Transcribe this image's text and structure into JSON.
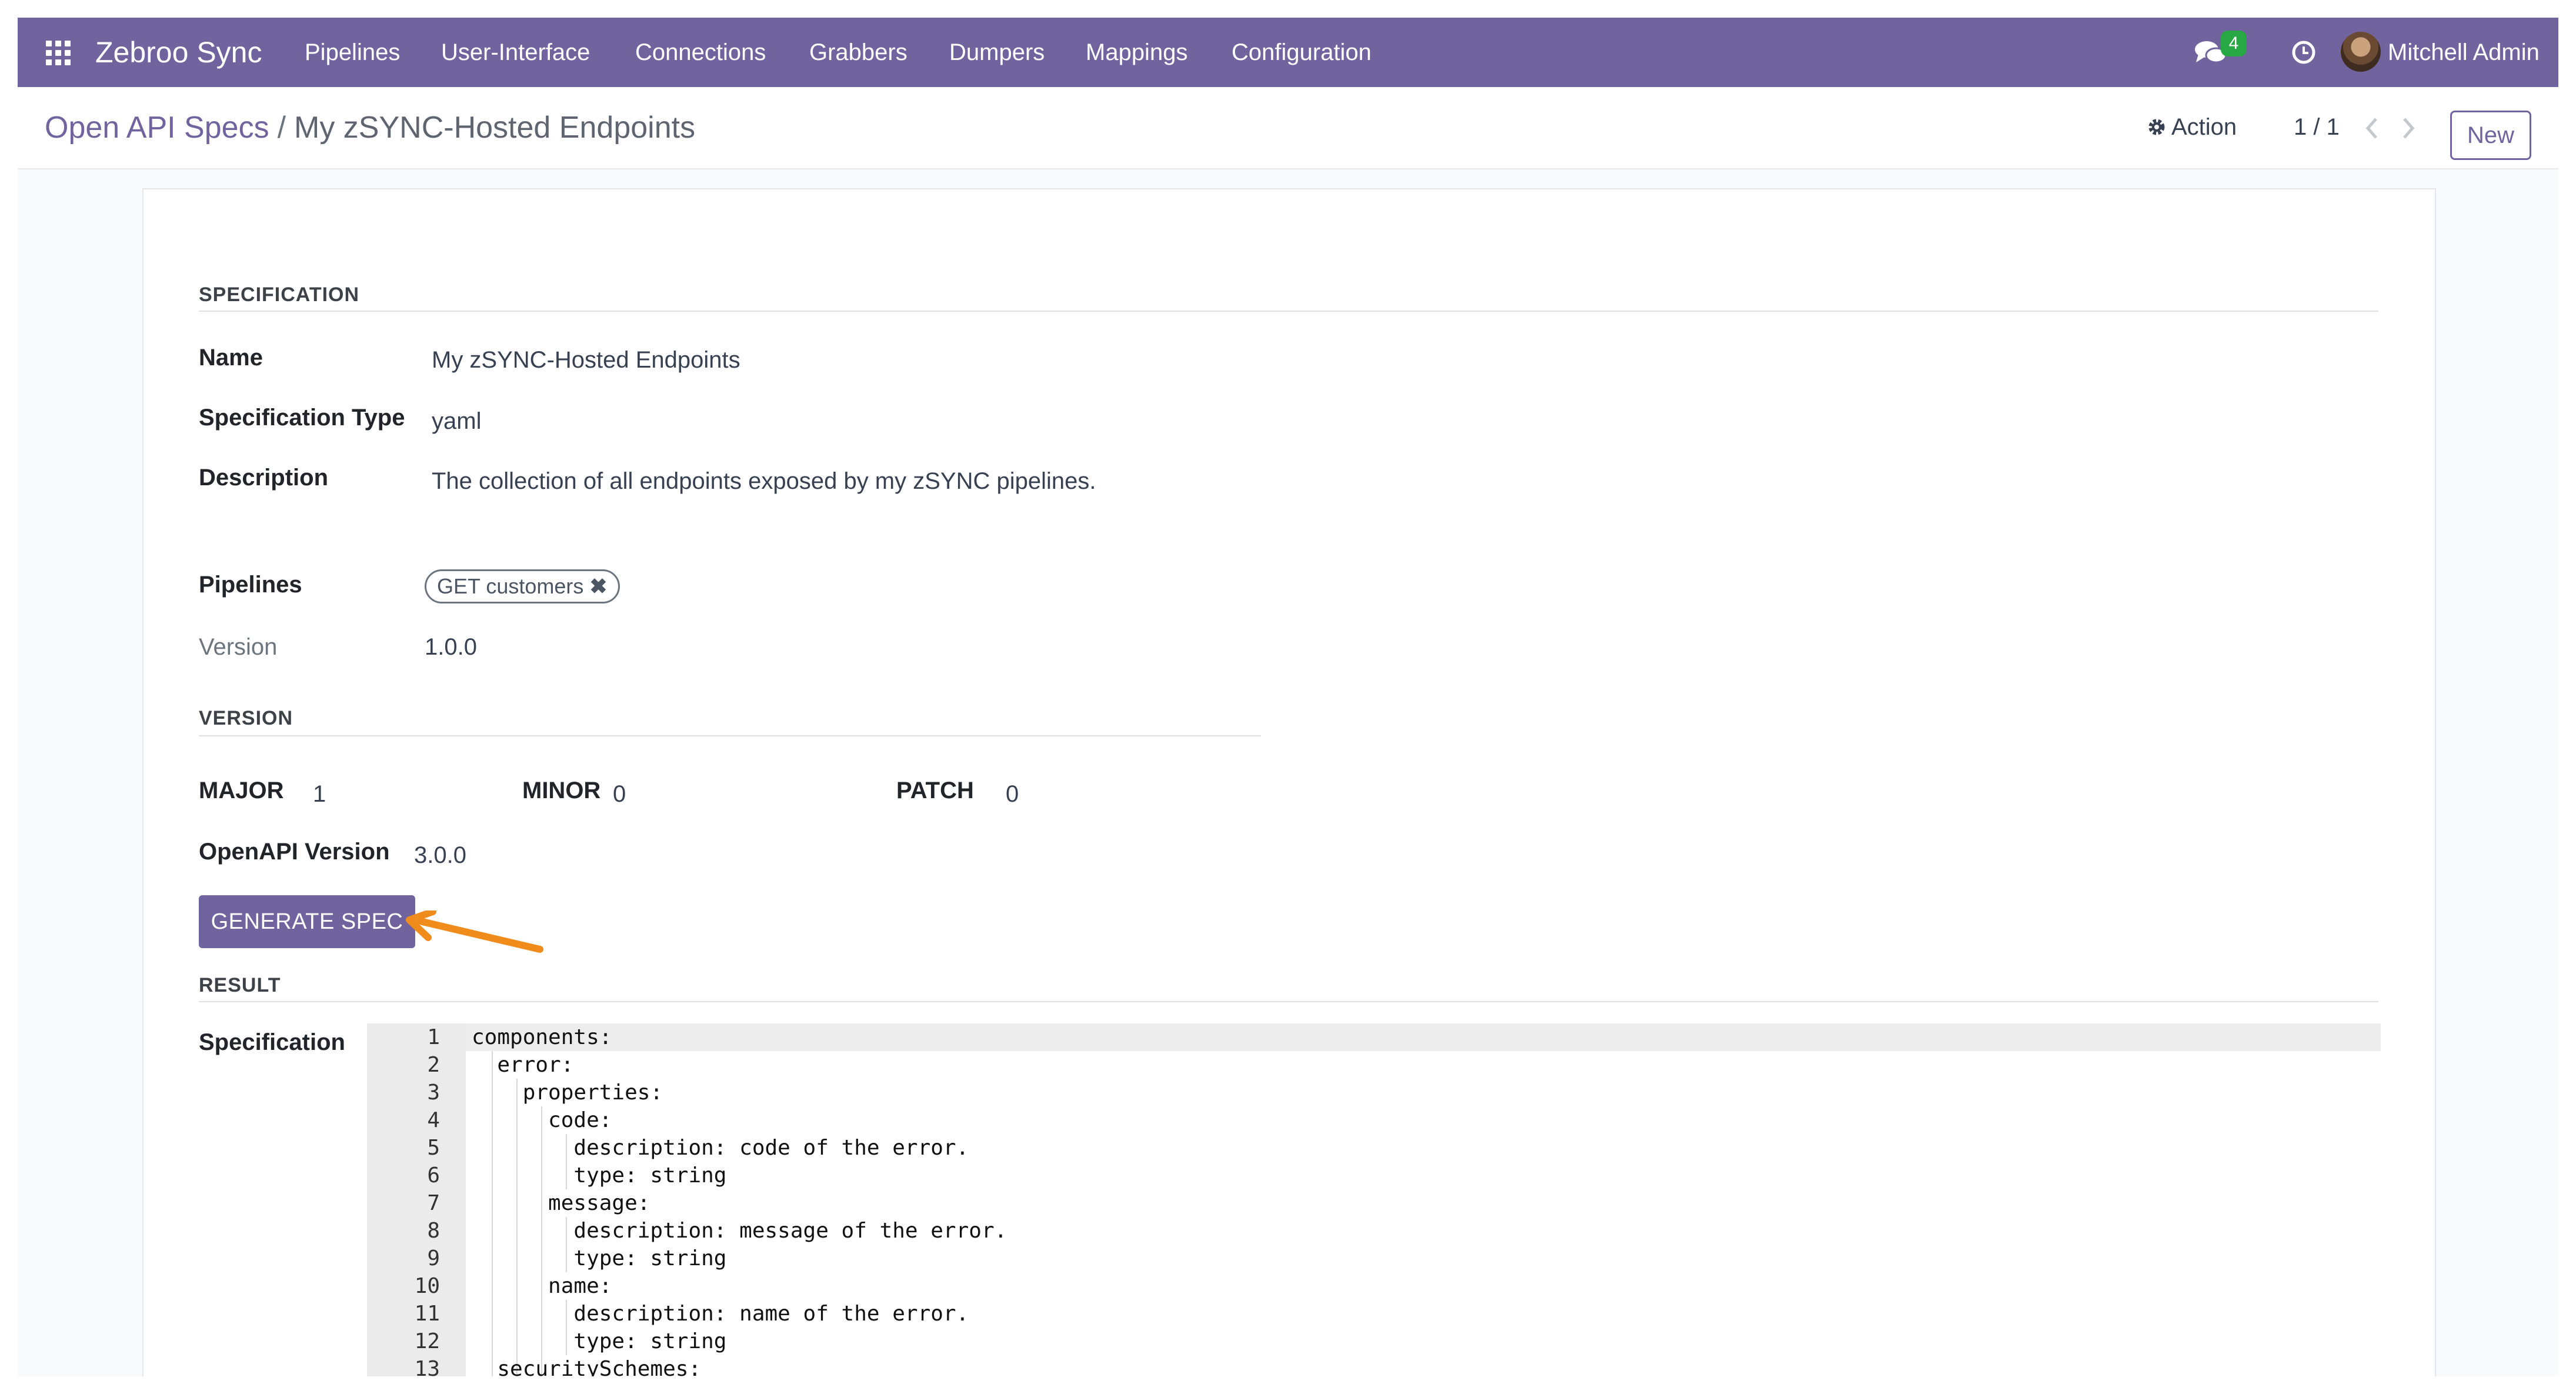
{
  "navbar": {
    "brand": "Zebroo Sync",
    "menu": [
      "Pipelines",
      "User-Interface",
      "Connections",
      "Grabbers",
      "Dumpers",
      "Mappings",
      "Configuration"
    ],
    "messages_count": "4",
    "user_name": "Mitchell Admin",
    "icons": [
      "apps-icon",
      "chat-icon",
      "clock-icon",
      "avatar"
    ]
  },
  "breadcrumb": {
    "parent": "Open API Specs",
    "separator": "/",
    "current": "My zSYNC-Hosted Endpoints"
  },
  "controls": {
    "action_label": "Action",
    "pager": "1 / 1",
    "new_label": "New"
  },
  "specification": {
    "section_title": "SPECIFICATION",
    "name_label": "Name",
    "name_value": "My zSYNC-Hosted Endpoints",
    "type_label": "Specification Type",
    "type_value": "yaml",
    "description_label": "Description",
    "description_value": "The collection of all endpoints exposed by my zSYNC pipelines.",
    "pipelines_label": "Pipelines",
    "pipeline_tag": "GET customers",
    "version_label": "Version",
    "version_value": "1.0.0"
  },
  "version": {
    "section_title": "VERSION",
    "major_label": "MAJOR",
    "major_value": "1",
    "minor_label": "MINOR",
    "minor_value": "0",
    "patch_label": "PATCH",
    "patch_value": "0",
    "openapi_label": "OpenAPI Version",
    "openapi_value": "3.0.0"
  },
  "generate_button": "GENERATE SPEC",
  "result": {
    "section_title": "RESULT",
    "spec_label": "Specification",
    "line_numbers": [
      "1",
      "2",
      "3",
      "4",
      "5",
      "6",
      "7",
      "8",
      "9",
      "10",
      "11",
      "12",
      "13"
    ],
    "lines": [
      "components:",
      "  error:",
      "    properties:",
      "      code:",
      "        description: code of the error.",
      "        type: string",
      "      message:",
      "        description: message of the error.",
      "        type: string",
      "      name:",
      "        description: name of the error.",
      "        type: string",
      "  securitySchemes:"
    ]
  },
  "colors": {
    "brand": "#71639e",
    "badge": "#28a745",
    "annotation_arrow": "#f08c1c"
  }
}
